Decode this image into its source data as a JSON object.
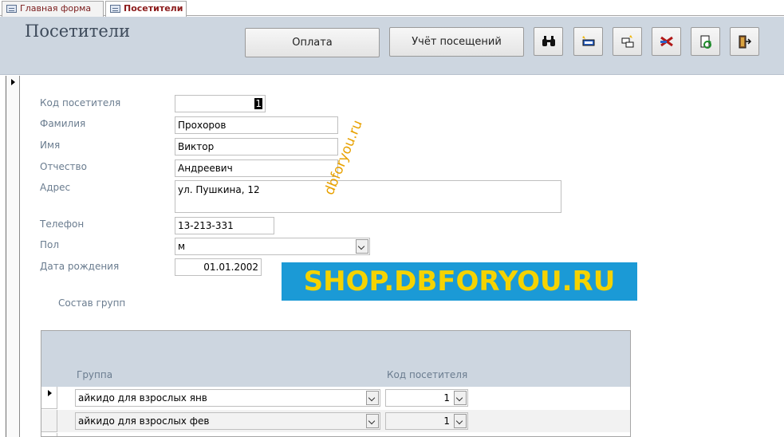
{
  "tabs": [
    {
      "label": "Главная форма",
      "active": false
    },
    {
      "label": "Посетители",
      "active": true
    }
  ],
  "header": {
    "title": "Посетители",
    "buttons": {
      "payment": "Оплата",
      "attendance": "Учёт посещений"
    },
    "icon_buttons": [
      "binoculars-icon",
      "new-record-icon",
      "copy-record-icon",
      "delete-record-icon",
      "refresh-icon",
      "exit-icon"
    ]
  },
  "form": {
    "visitor_code_label": "Код посетителя",
    "visitor_code_value": "1",
    "surname_label": "Фамилия",
    "surname_value": "Прохоров",
    "name_label": "Имя",
    "name_value": "Виктор",
    "patronymic_label": "Отчество",
    "patronymic_value": "Андреевич",
    "address_label": "Адрес",
    "address_value": "ул. Пушкина, 12",
    "phone_label": "Телефон",
    "phone_value": "13-213-331",
    "gender_label": "Пол",
    "gender_value": "м",
    "birthdate_label": "Дата рождения",
    "birthdate_value": "01.01.2002",
    "groups_label": "Состав групп"
  },
  "watermarks": {
    "rotated": "dbforyou.ru",
    "banner": "SHOP.DBFORYOU.RU"
  },
  "subform": {
    "columns": {
      "group": "Группа",
      "visitor_code": "Код посетителя"
    },
    "rows": [
      {
        "group": "айкидо для взрослых янв",
        "code": "1"
      },
      {
        "group": "айкидо для взрослых фев",
        "code": "1"
      }
    ]
  },
  "colors": {
    "header_bg": "#cdd6e0",
    "label": "#6a7c8f",
    "banner_bg": "#1b9ad6",
    "banner_text": "#f5d300"
  }
}
